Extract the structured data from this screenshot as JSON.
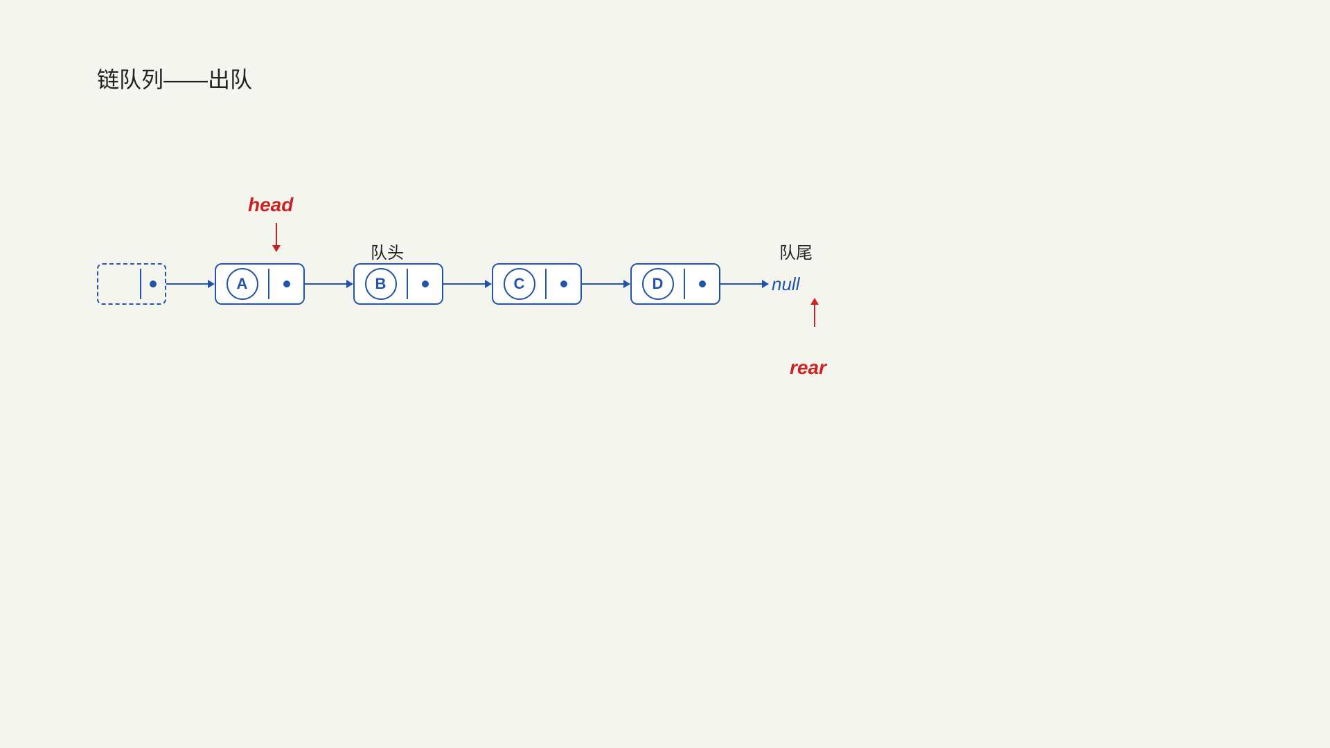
{
  "title": "链队列——出队",
  "head_label": "head",
  "rear_label": "rear",
  "queue_head_label": "队头",
  "queue_tail_label": "队尾",
  "null_label": "null",
  "nodes": [
    {
      "id": "head_node",
      "type": "head",
      "letter": ""
    },
    {
      "id": "node_a",
      "type": "regular",
      "letter": "A"
    },
    {
      "id": "node_b",
      "type": "regular",
      "letter": "B"
    },
    {
      "id": "node_c",
      "type": "regular",
      "letter": "C"
    },
    {
      "id": "node_d",
      "type": "regular",
      "letter": "D"
    }
  ],
  "colors": {
    "blue": "#2255aa",
    "red": "#cc2222",
    "bg": "#f5f5f0"
  }
}
